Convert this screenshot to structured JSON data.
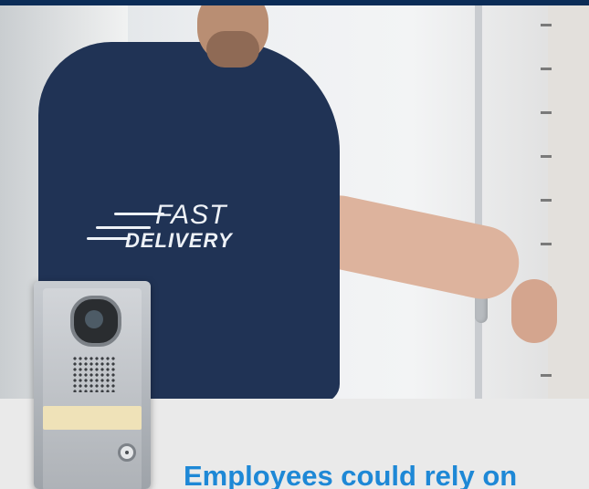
{
  "hero": {
    "shirt_logo": {
      "line1": "FAST",
      "line2": "DELIVERY"
    }
  },
  "caption": {
    "text": "Employees could rely on"
  },
  "colors": {
    "top_bar": "#0b2c57",
    "caption": "#1e88d6",
    "shirt": "#203355"
  }
}
